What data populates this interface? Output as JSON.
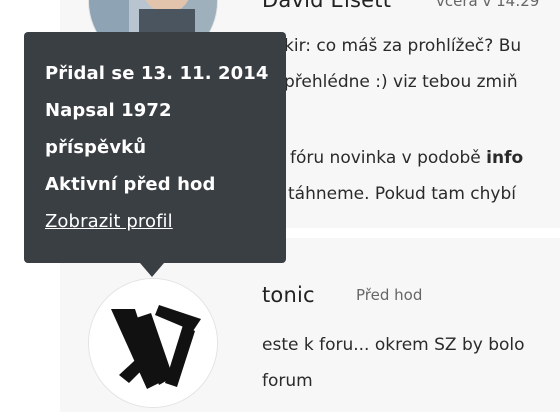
{
  "tooltip": {
    "joined": "Přidal se 13. 11. 2014",
    "posts_line1": "Napsal 1972",
    "posts_line2": "příspěvků",
    "active": "Aktivní před hod",
    "profile_link": "Zobrazit profil"
  },
  "post_top": {
    "author": "David Elsett",
    "time": "včera v 14:29",
    "line1": "kir: co máš za prohlížeč? Bu",
    "line2": "přehlédne :) viz tebou zmiň",
    "line3_pre": "fóru novinka v podobě ",
    "line3_bold": "info",
    "line4": "táhneme. Pokud tam chybí"
  },
  "post_bottom": {
    "author": "tonic",
    "time": "Před hod",
    "line1": "este k foru... okrem SZ by bolo",
    "line2": "forum"
  }
}
